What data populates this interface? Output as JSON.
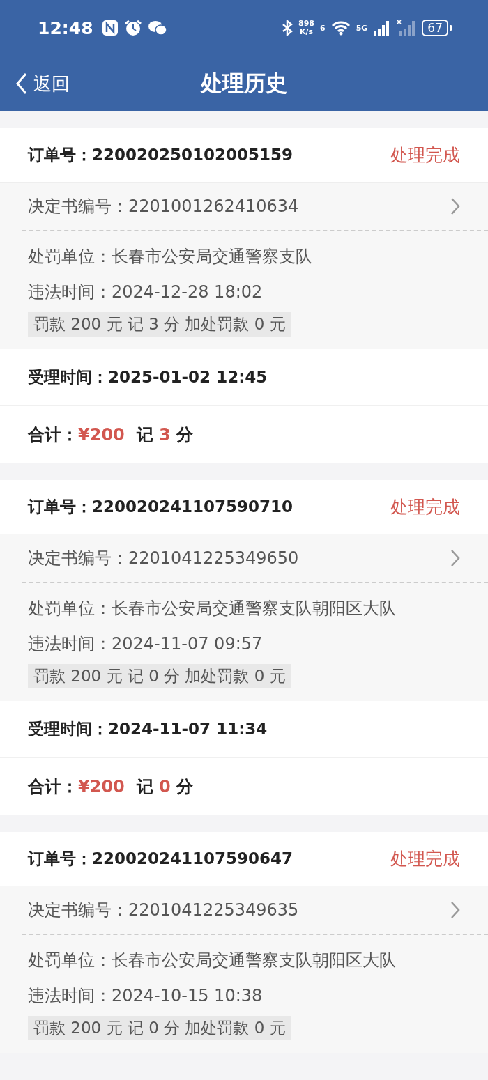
{
  "status_bar": {
    "time": "12:48",
    "speed_value": "898",
    "speed_unit": "K/s",
    "wifi_label": "6",
    "network": "5G",
    "battery": "67"
  },
  "nav": {
    "back": "返回",
    "title": "处理历史"
  },
  "orders": [
    {
      "order_label": "订单号：",
      "order_no": "220020250102005159",
      "status": "处理完成",
      "decision_label": "决定书编号：",
      "decision_no": "2201001262410634",
      "unit_label": "处罚单位：",
      "unit": "长春市公安局交通警察支队",
      "time_label": "违法时间：",
      "time": "2024-12-28 18:02",
      "fine": "罚款 200 元 记 3 分 加处罚款 0 元",
      "accept_label": "受理时间：",
      "accept_time": "2025-01-02 12:45",
      "total_label": "合计：",
      "amount": "¥200",
      "points_prefix": "记",
      "points": "3",
      "points_suffix": "分"
    },
    {
      "order_label": "订单号：",
      "order_no": "220020241107590710",
      "status": "处理完成",
      "decision_label": "决定书编号：",
      "decision_no": "2201041225349650",
      "unit_label": "处罚单位：",
      "unit": "长春市公安局交通警察支队朝阳区大队",
      "time_label": "违法时间：",
      "time": "2024-11-07 09:57",
      "fine": "罚款 200 元 记 0 分 加处罚款 0 元",
      "accept_label": "受理时间：",
      "accept_time": "2024-11-07 11:34",
      "total_label": "合计：",
      "amount": "¥200",
      "points_prefix": "记",
      "points": "0",
      "points_suffix": "分"
    },
    {
      "order_label": "订单号：",
      "order_no": "220020241107590647",
      "status": "处理完成",
      "decision_label": "决定书编号：",
      "decision_no": "2201041225349635",
      "unit_label": "处罚单位：",
      "unit": "长春市公安局交通警察支队朝阳区大队",
      "time_label": "违法时间：",
      "time": "2024-10-15 10:38",
      "fine": "罚款 200 元 记 0 分 加处罚款 0 元"
    }
  ]
}
